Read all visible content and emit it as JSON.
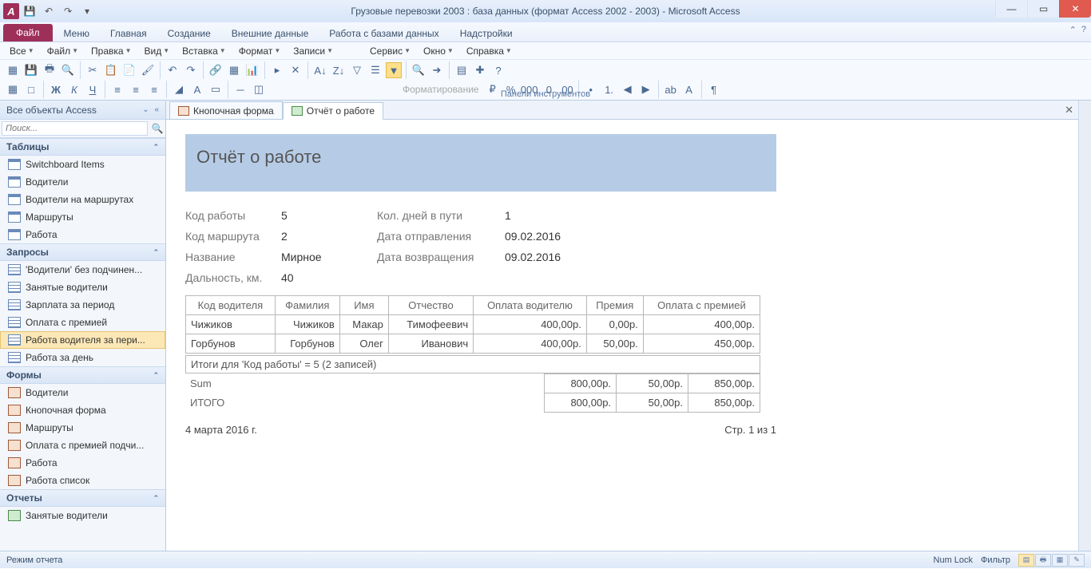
{
  "window": {
    "title": "Грузовые перевозки 2003 : база данных (формат Access 2002 - 2003)  -  Microsoft Access",
    "app_letter": "A"
  },
  "ribbon_tabs": {
    "file": "Файл",
    "items": [
      "Меню",
      "Главная",
      "Создание",
      "Внешние данные",
      "Работа с базами данных",
      "Надстройки"
    ]
  },
  "menubar": [
    "Все",
    "Файл",
    "Правка",
    "Вид",
    "Вставка",
    "Формат",
    "Записи",
    "Сервис",
    "Окно",
    "Справка"
  ],
  "toolbar": {
    "formatting_label": "Форматирование",
    "panels_label": "Панели инструментов"
  },
  "nav": {
    "header": "Все объекты Access",
    "search_placeholder": "Поиск...",
    "groups": [
      {
        "title": "Таблицы",
        "kind": "table",
        "items": [
          "Switchboard Items",
          "Водители",
          "Водители на маршрутах",
          "Маршруты",
          "Работа"
        ]
      },
      {
        "title": "Запросы",
        "kind": "query",
        "items": [
          "'Водители' без подчинен...",
          "Занятые водители",
          "Зарплата за период",
          "Оплата с премией",
          "Работа водителя за пери...",
          "Работа за день"
        ],
        "selected": 4
      },
      {
        "title": "Формы",
        "kind": "form",
        "items": [
          "Водители",
          "Кнопочная форма",
          "Маршруты",
          "Оплата с премией подчи...",
          "Работа",
          "Работа список"
        ]
      },
      {
        "title": "Отчеты",
        "kind": "report",
        "items": [
          "Занятые водители"
        ]
      }
    ]
  },
  "doc_tabs": [
    {
      "label": "Кнопочная форма",
      "icon": "form-i",
      "active": false
    },
    {
      "label": "Отчёт о работе",
      "icon": "report-i",
      "active": true
    }
  ],
  "report": {
    "title": "Отчёт о работе",
    "fields_left": [
      {
        "label": "Код работы",
        "value": "5"
      },
      {
        "label": "Код маршрута",
        "value": "2"
      },
      {
        "label": "Название",
        "value": "Мирное"
      },
      {
        "label": "Дальность, км.",
        "value": "40"
      }
    ],
    "fields_right": [
      {
        "label": "Кол. дней в пути",
        "value": "1"
      },
      {
        "label": "Дата отправления",
        "value": "09.02.2016"
      },
      {
        "label": "Дата возвращения",
        "value": "09.02.2016"
      }
    ],
    "columns": [
      "Код водителя",
      "Фамилия",
      "Имя",
      "Отчество",
      "Оплата водителю",
      "Премия",
      "Оплата с премией"
    ],
    "rows": [
      {
        "code": "Чижиков",
        "fam": "Чижиков",
        "name": "Макар",
        "patr": "Тимофеевич",
        "pay": "400,00р.",
        "bonus": "0,00р.",
        "total": "400,00р."
      },
      {
        "code": "Горбунов",
        "fam": "Горбунов",
        "name": "Олег",
        "patr": "Иванович",
        "pay": "400,00р.",
        "bonus": "50,00р.",
        "total": "450,00р."
      }
    ],
    "group_footer": "Итоги для 'Код работы' =  5 (2 записей)",
    "sum_label": "Sum",
    "sum": {
      "pay": "800,00р.",
      "bonus": "50,00р.",
      "total": "850,00р."
    },
    "grand_label": "ИТОГО",
    "grand": {
      "pay": "800,00р.",
      "bonus": "50,00р.",
      "total": "850,00р."
    },
    "date": "4 марта 2016 г.",
    "page": "Стр. 1 из 1"
  },
  "statusbar": {
    "mode": "Режим отчета",
    "numlock": "Num Lock",
    "filter": "Фильтр"
  }
}
